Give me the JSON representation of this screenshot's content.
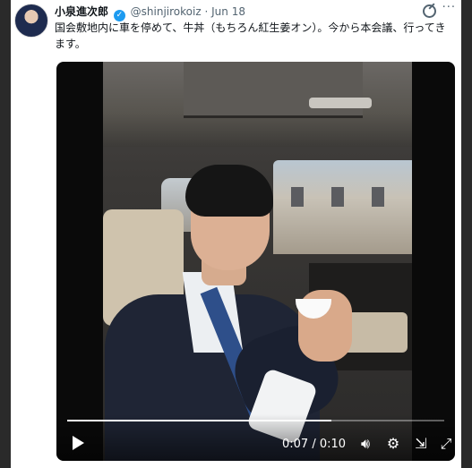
{
  "tweet": {
    "author_name": "小泉進次郎",
    "verified_icon": "verified-badge-icon",
    "handle": "@shinjirokoiz",
    "separator": "·",
    "date": "Jun 18",
    "text": "国会敷地内に車を停めて、牛丼（もちろん紅生姜オン）。今から本会議、行ってきます。"
  },
  "video": {
    "current_time": "0:07",
    "time_separator": "/",
    "duration": "0:10",
    "progress": 0.7
  },
  "icons": {
    "grok": "grok-icon",
    "more": "more-icon",
    "play": "play-icon",
    "volume": "volume-icon",
    "settings": "settings-gear-icon",
    "exit": "exit-icon",
    "fullscreen": "fullscreen-icon"
  },
  "colors": {
    "verified": "#1d9bf0",
    "secondary_text": "#536471",
    "primary_text": "#0f1419"
  }
}
